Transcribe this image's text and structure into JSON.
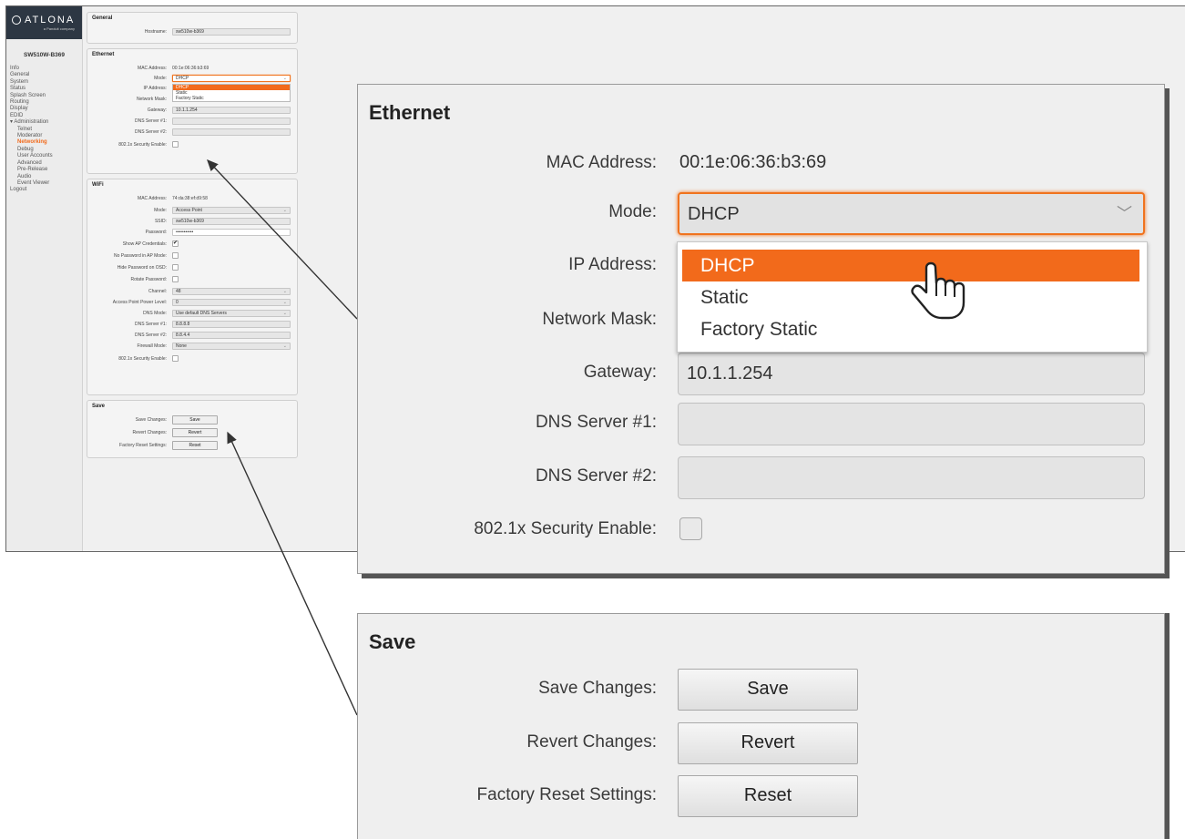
{
  "brand": {
    "logo_text": "ATLONA",
    "logo_sub": "a Panduit company"
  },
  "device_name": "SW510W-B369",
  "nav": [
    {
      "label": "Info",
      "level": 0
    },
    {
      "label": "General",
      "level": 0
    },
    {
      "label": "System",
      "level": 0
    },
    {
      "label": "Status",
      "level": 0
    },
    {
      "label": "Splash Screen",
      "level": 0
    },
    {
      "label": "Routing",
      "level": 0
    },
    {
      "label": "Display",
      "level": 0
    },
    {
      "label": "EDID",
      "level": 0
    },
    {
      "label": "▾ Administration",
      "level": 0
    },
    {
      "label": "Telnet",
      "level": 1
    },
    {
      "label": "Moderator",
      "level": 1
    },
    {
      "label": "Networking",
      "level": 1,
      "active": true
    },
    {
      "label": "Debug",
      "level": 1
    },
    {
      "label": "User Accounts",
      "level": 1
    },
    {
      "label": "Advanced",
      "level": 1
    },
    {
      "label": "Pre-Release",
      "level": 1
    },
    {
      "label": "Audio",
      "level": 1
    },
    {
      "label": "Event Viewer",
      "level": 1
    },
    {
      "label": "Logout",
      "level": 0
    }
  ],
  "general": {
    "title": "General",
    "hostname_label": "Hostname:",
    "hostname_value": "sw510w-b369"
  },
  "ethernet": {
    "title": "Ethernet",
    "mac_label": "MAC Address:",
    "mac_value": "00:1e:06:36:b3:69",
    "mode_label": "Mode:",
    "mode_value": "DHCP",
    "mode_options": [
      "DHCP",
      "Static",
      "Factory Static"
    ],
    "ip_label": "IP Address:",
    "mask_label": "Network Mask:",
    "gateway_label": "Gateway:",
    "gateway_value": "10.1.1.254",
    "dns1_label": "DNS Server #1:",
    "dns1_value": "",
    "dns2_label": "DNS Server #2:",
    "dns2_value": "",
    "security_label": "802.1x Security Enable:"
  },
  "wifi": {
    "title": "WiFi",
    "mac_label": "MAC Address:",
    "mac_value": "74:da:38:ef:d9:58",
    "mode_label": "Mode:",
    "mode_value": "Access Point",
    "ssid_label": "SSID:",
    "ssid_value": "sw510w-b369",
    "password_label": "Password:",
    "password_value": "•••••••••••",
    "show_ap_label": "Show AP Credentials:",
    "show_ap_checked": "✔",
    "no_pw_label": "No Password in AP Mode:",
    "hide_pw_label": "Hide Password on OSD:",
    "rotate_label": "Rotate Password:",
    "channel_label": "Channel:",
    "channel_value": "48",
    "power_label": "Access Point Power Level:",
    "power_value": "0",
    "dns_mode_label": "DNS Mode:",
    "dns_mode_value": "Use default DNS Servers",
    "dns1_label": "DNS Server #1:",
    "dns1_value": "8.8.8.8",
    "dns2_label": "DNS Server #2:",
    "dns2_value": "8.8.4.4",
    "firewall_label": "Firewall Mode:",
    "firewall_value": "None",
    "security_label": "802.1x Security Enable:"
  },
  "save": {
    "title": "Save",
    "save_label": "Save Changes:",
    "save_button": "Save",
    "revert_label": "Revert Changes:",
    "revert_button": "Revert",
    "reset_label": "Factory Reset Settings:",
    "reset_button": "Reset"
  },
  "colors": {
    "accent": "#f26a1b",
    "sidebar_header": "#2d3743",
    "panel_bg": "#efefef"
  },
  "icons": {
    "chevron": "chevron-down-icon",
    "pointer": "hand-pointer-icon"
  }
}
